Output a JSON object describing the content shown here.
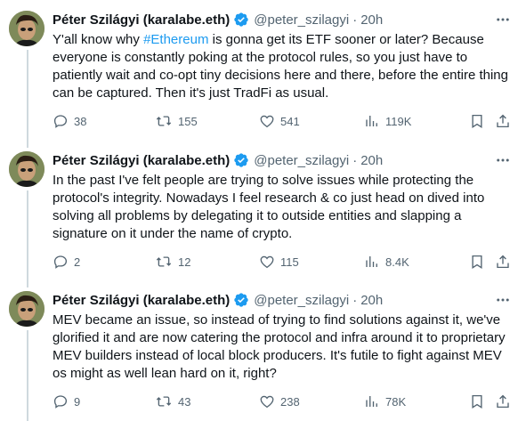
{
  "tweets": [
    {
      "author_name": "Péter Szilágyi (karalabe.eth)",
      "handle": "@peter_szilagyi",
      "separator": "·",
      "time": "20h",
      "text_before": "Y'all know why ",
      "hashtag": "#Ethereum",
      "text_after": " is gonna get its ETF sooner or later? Because everyone is constantly poking at the protocol rules, so you just have to patiently wait and co-opt tiny decisions here and there, before the entire thing can be captured. Then it's just TradFi as usual.",
      "replies": "38",
      "reposts": "155",
      "likes": "541",
      "views": "119K"
    },
    {
      "author_name": "Péter Szilágyi (karalabe.eth)",
      "handle": "@peter_szilagyi",
      "separator": "·",
      "time": "20h",
      "text": "In the past I've felt people are trying to solve issues while protecting the protocol's integrity. Nowadays I feel research & co just head on dived into solving all problems by delegating it to outside entities and slapping a signature on it under the name of crypto.",
      "replies": "2",
      "reposts": "12",
      "likes": "115",
      "views": "8.4K"
    },
    {
      "author_name": "Péter Szilágyi (karalabe.eth)",
      "handle": "@peter_szilagyi",
      "separator": "·",
      "time": "20h",
      "text": "MEV became an issue, so instead of trying to find solutions against it, we've glorified it and are now catering the protocol and infra around it to proprietary MEV builders instead of local block producers. It's futile to fight against MEV os might as well lean hard on it, right?",
      "replies": "9",
      "reposts": "43",
      "likes": "238",
      "views": "78K"
    }
  ],
  "colors": {
    "text": "#0f1419",
    "secondary": "#536471",
    "link": "#1d9bf0",
    "verified": "#1d9bf0",
    "thread_line": "#cfd9de"
  },
  "icons": [
    "verified-badge-icon",
    "more-icon",
    "reply-icon",
    "retweet-icon",
    "like-icon",
    "views-icon",
    "bookmark-icon",
    "share-icon"
  ]
}
